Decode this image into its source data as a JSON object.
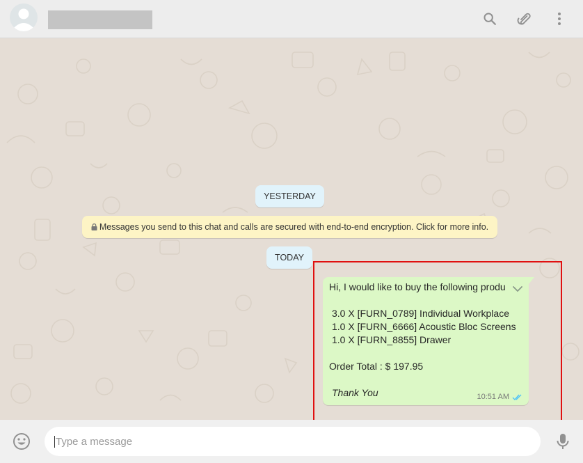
{
  "header": {
    "avatar_icon": "default-user-avatar",
    "icons": [
      "search-icon",
      "attach-icon",
      "menu-icon"
    ]
  },
  "chat": {
    "date_yesterday": "YESTERDAY",
    "encryption_notice": "Messages you send to this chat and calls are secured with end-to-end encryption. Click for more info.",
    "date_today": "TODAY",
    "message": {
      "line1": "Hi, I would like to buy the following produ",
      "items": [
        "3.0 X [FURN_0789] Individual Workplace",
        "1.0 X [FURN_6666] Acoustic Bloc Screens",
        "1.0 X [FURN_8855] Drawer"
      ],
      "total": "Order Total : $ 197.95",
      "thanks": "Thank You",
      "time": "10:51 AM",
      "status": "read"
    }
  },
  "footer": {
    "placeholder": "Type a message",
    "icons": [
      "emoji-icon",
      "mic-icon"
    ]
  },
  "colors": {
    "outgoing_bubble": "#dcf8c6",
    "date_pill": "#e1f3fb",
    "notice": "#fdf4c5",
    "read_ticks": "#4fc3f7",
    "highlight_box": "#e01010"
  }
}
